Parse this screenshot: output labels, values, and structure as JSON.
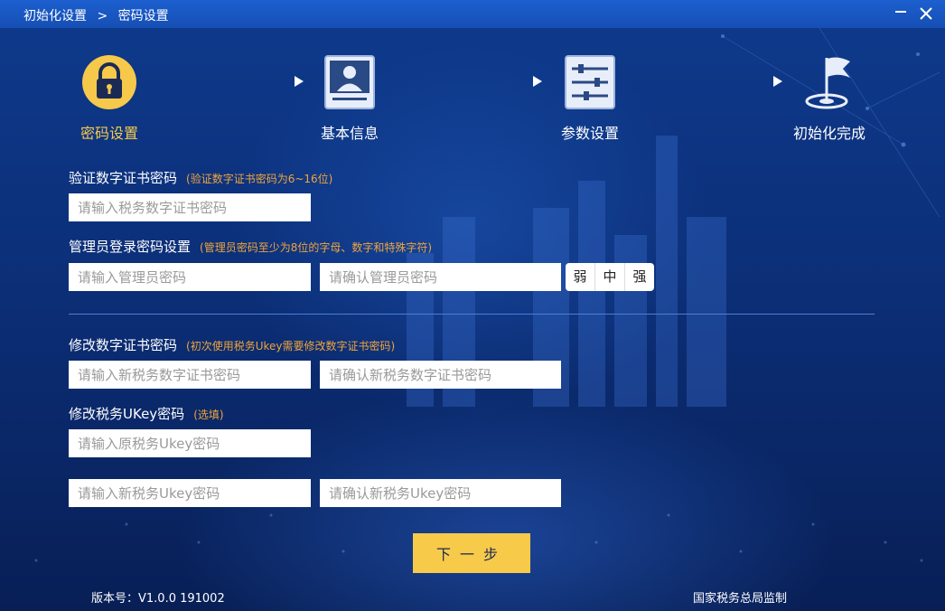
{
  "titlebar": {
    "crumb_root": "初始化设置",
    "crumb_sep": ">",
    "crumb_current": "密码设置"
  },
  "steps": [
    {
      "label": "密码设置",
      "icon": "lock-icon",
      "active": true
    },
    {
      "label": "基本信息",
      "icon": "id-card-icon",
      "active": false
    },
    {
      "label": "参数设置",
      "icon": "sliders-icon",
      "active": false
    },
    {
      "label": "初始化完成",
      "icon": "flag-icon",
      "active": false
    }
  ],
  "sections": {
    "cert_password": {
      "title": "验证数字证书密码",
      "hint": "(验证数字证书密码为6~16位)",
      "input_placeholder": "请输入税务数字证书密码"
    },
    "admin_password": {
      "title": "管理员登录密码设置",
      "hint": "(管理员密码至少为8位的字母、数字和特殊字符)",
      "input_placeholder": "请输入管理员密码",
      "confirm_placeholder": "请确认管理员密码",
      "strength": [
        "弱",
        "中",
        "强"
      ]
    },
    "change_cert": {
      "title": "修改数字证书密码",
      "hint": "(初次使用税务Ukey需要修改数字证书密码)",
      "new_placeholder": "请输入新税务数字证书密码",
      "confirm_placeholder": "请确认新税务数字证书密码"
    },
    "change_ukey": {
      "title": "修改税务UKey密码",
      "hint": "(选填)",
      "old_placeholder": "请输入原税务Ukey密码",
      "new_placeholder": "请输入新税务Ukey密码",
      "confirm_placeholder": "请确认新税务Ukey密码"
    }
  },
  "next_button": "下一步",
  "footer": {
    "version": "版本号：V1.0.0 191002",
    "supervisor": "国家税务总局监制"
  },
  "colors": {
    "accent": "#f8ca4a",
    "titlebar": "#1a58c4",
    "background": "#0c2f78",
    "hint": "#f0a53a"
  }
}
